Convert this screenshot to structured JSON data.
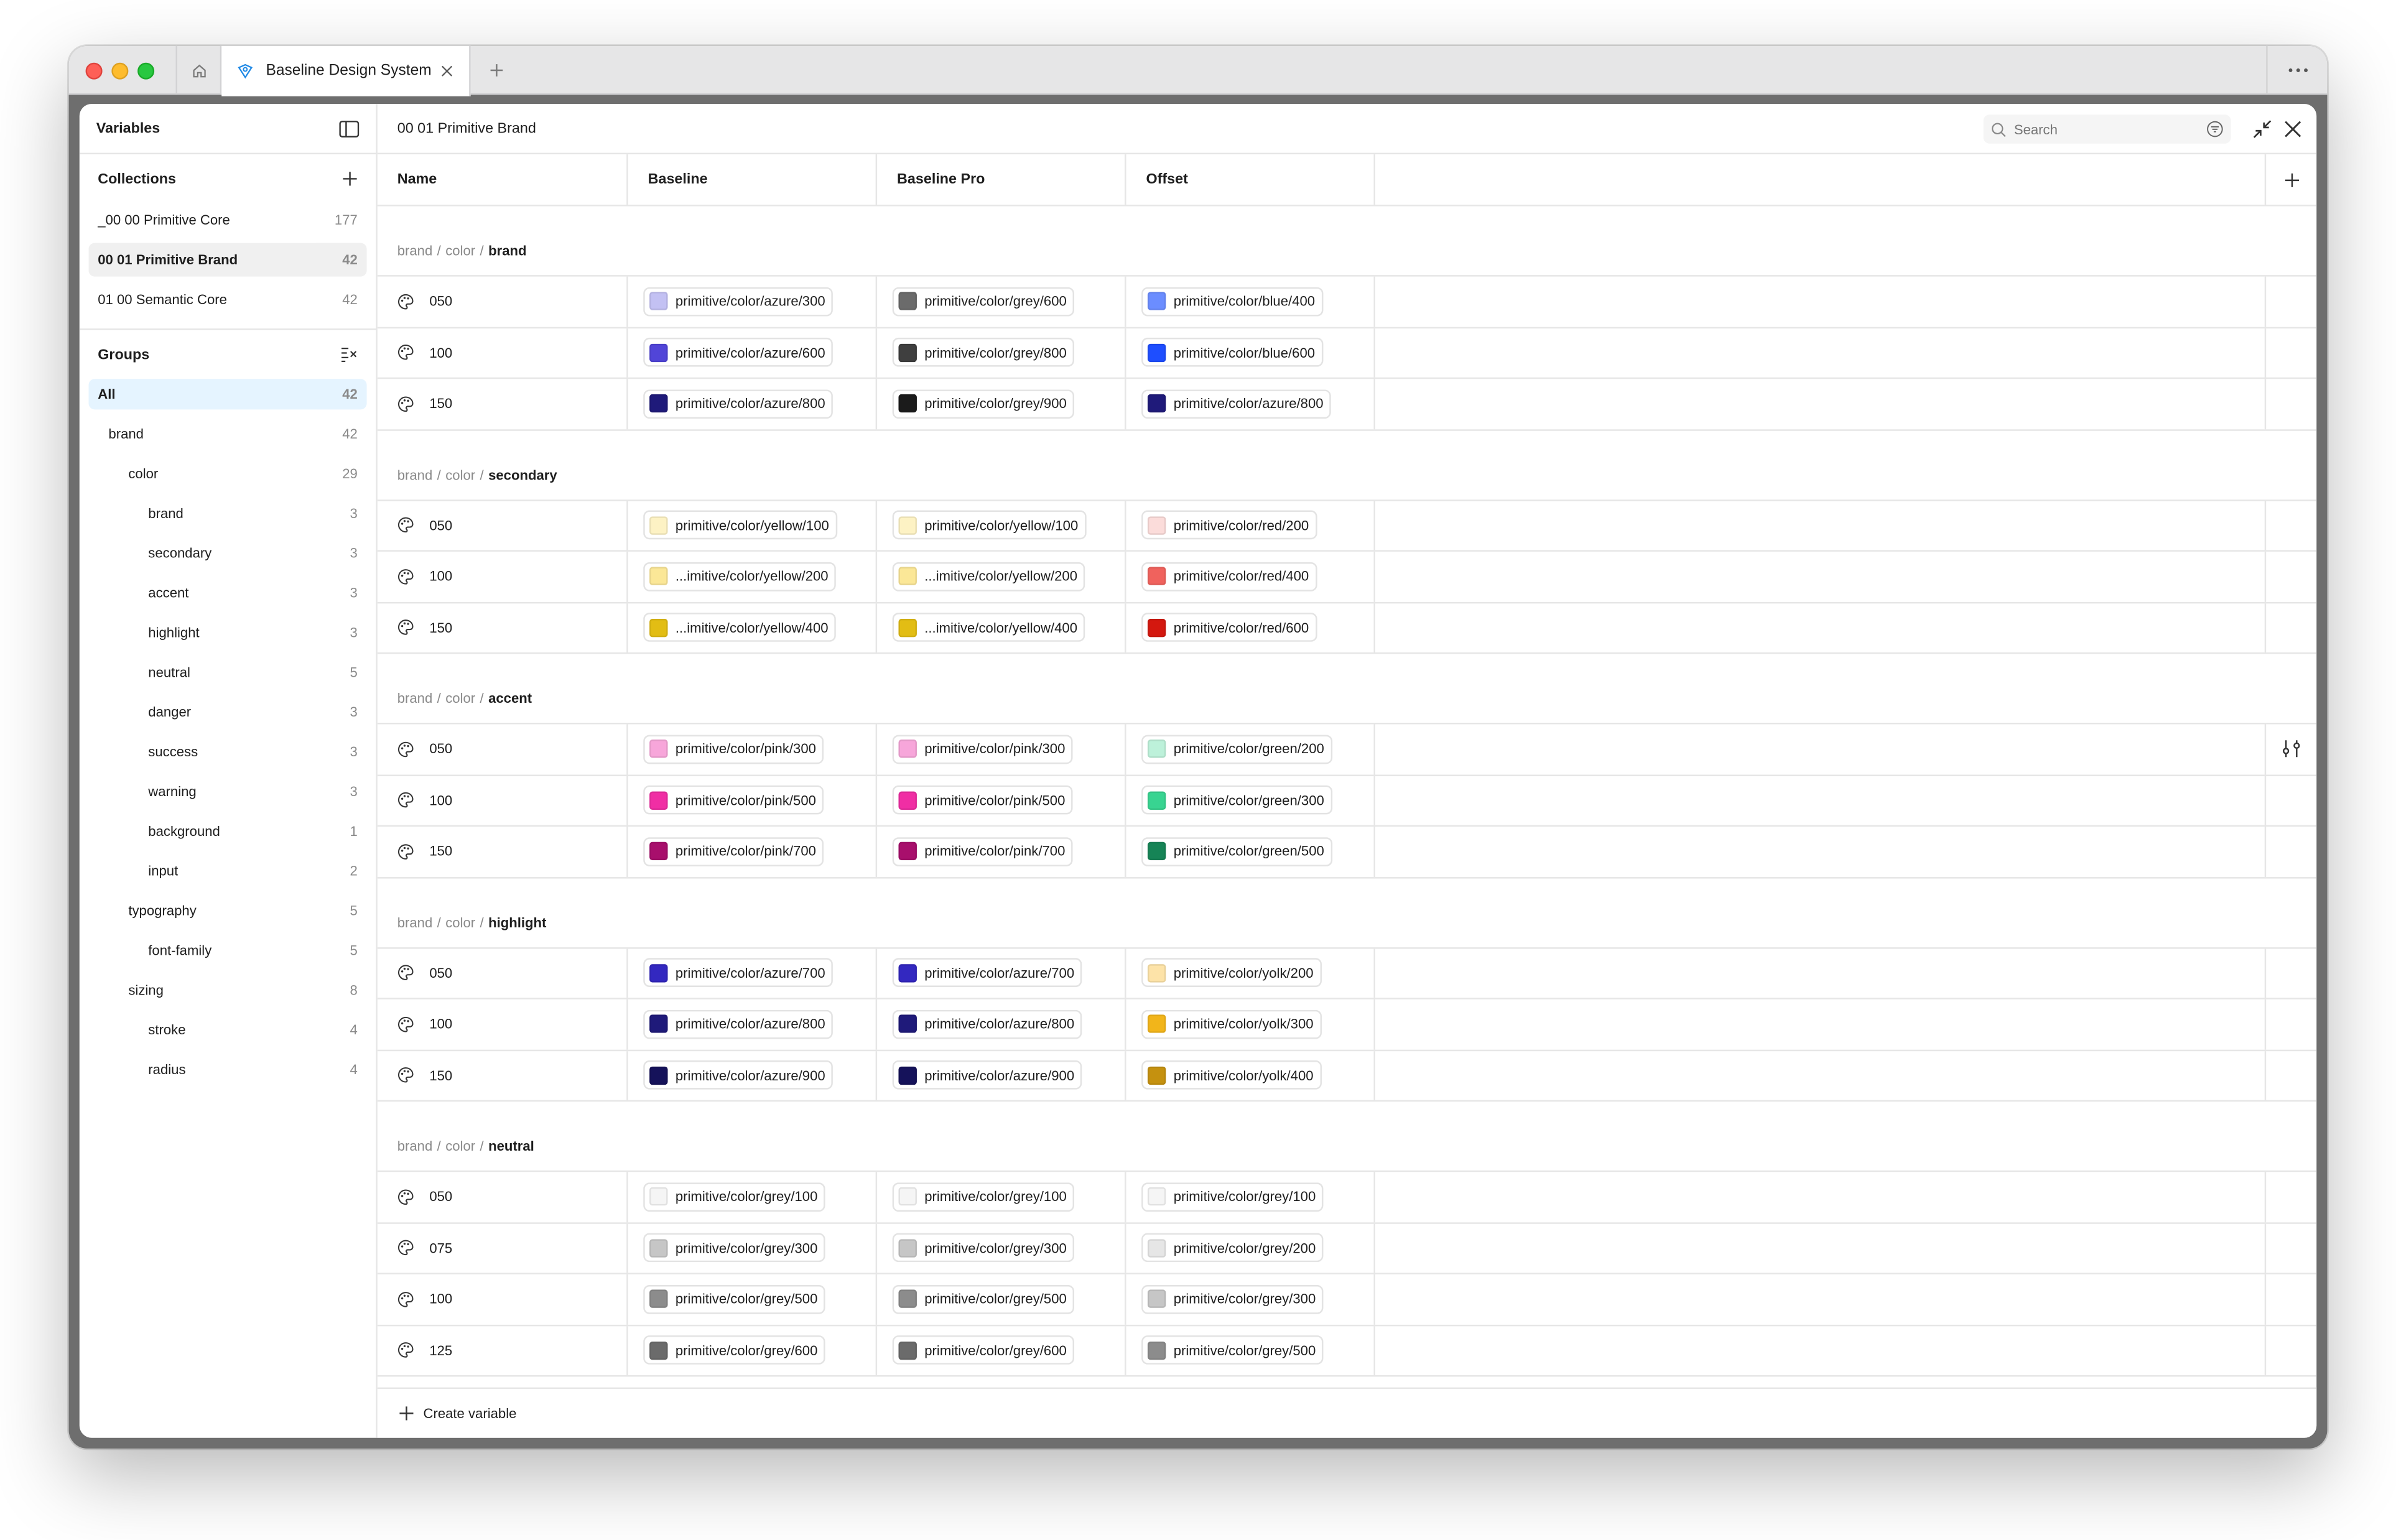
{
  "app": {
    "tab_title": "Baseline Design System",
    "icons": [
      "home-icon",
      "app-logo-icon",
      "close-icon",
      "plus-icon",
      "more-icon"
    ]
  },
  "sidebar": {
    "title": "Variables",
    "collections_label": "Collections",
    "collections": [
      {
        "name": "_00 00 Primitive Core",
        "count": "177",
        "active": false
      },
      {
        "name": "00 01 Primitive Brand",
        "count": "42",
        "active": true
      },
      {
        "name": "01 00 Semantic Core",
        "count": "42",
        "active": false
      }
    ],
    "groups_label": "Groups",
    "groups": [
      {
        "name": "All",
        "count": "42",
        "level": 0,
        "active": true
      },
      {
        "name": "brand",
        "count": "42",
        "level": 1
      },
      {
        "name": "color",
        "count": "29",
        "level": 2
      },
      {
        "name": "brand",
        "count": "3",
        "level": 3
      },
      {
        "name": "secondary",
        "count": "3",
        "level": 3
      },
      {
        "name": "accent",
        "count": "3",
        "level": 3
      },
      {
        "name": "highlight",
        "count": "3",
        "level": 3
      },
      {
        "name": "neutral",
        "count": "5",
        "level": 3
      },
      {
        "name": "danger",
        "count": "3",
        "level": 3
      },
      {
        "name": "success",
        "count": "3",
        "level": 3
      },
      {
        "name": "warning",
        "count": "3",
        "level": 3
      },
      {
        "name": "background",
        "count": "1",
        "level": 3
      },
      {
        "name": "input",
        "count": "2",
        "level": 3
      },
      {
        "name": "typography",
        "count": "5",
        "level": 2
      },
      {
        "name": "font-family",
        "count": "5",
        "level": 3
      },
      {
        "name": "sizing",
        "count": "8",
        "level": 2
      },
      {
        "name": "stroke",
        "count": "4",
        "level": 3
      },
      {
        "name": "radius",
        "count": "4",
        "level": 3
      }
    ]
  },
  "main": {
    "title": "00 01 Primitive Brand",
    "search_placeholder": "Search",
    "columns": {
      "name": "Name",
      "modes": [
        "Baseline",
        "Baseline Pro",
        "Offset"
      ]
    },
    "create_label": "Create variable",
    "groups": [
      {
        "path": [
          "brand",
          "color"
        ],
        "leaf": "brand",
        "rows": [
          {
            "name": "050",
            "values": [
              {
                "label": "primitive/color/azure/300",
                "color": "#c3c1f3"
              },
              {
                "label": "primitive/color/grey/600",
                "color": "#6b6b6b"
              },
              {
                "label": "primitive/color/blue/400",
                "color": "#6b8dff"
              }
            ]
          },
          {
            "name": "100",
            "values": [
              {
                "label": "primitive/color/azure/600",
                "color": "#5145d8"
              },
              {
                "label": "primitive/color/grey/800",
                "color": "#3f3f3f"
              },
              {
                "label": "primitive/color/blue/600",
                "color": "#1e4eff"
              }
            ]
          },
          {
            "name": "150",
            "values": [
              {
                "label": "primitive/color/azure/800",
                "color": "#1f1a7a"
              },
              {
                "label": "primitive/color/grey/900",
                "color": "#1b1b1b"
              },
              {
                "label": "primitive/color/azure/800",
                "color": "#1f1a7a"
              }
            ]
          }
        ]
      },
      {
        "path": [
          "brand",
          "color"
        ],
        "leaf": "secondary",
        "rows": [
          {
            "name": "050",
            "values": [
              {
                "label": "primitive/color/yellow/100",
                "color": "#fdf2c4"
              },
              {
                "label": "primitive/color/yellow/100",
                "color": "#fdf2c4"
              },
              {
                "label": "primitive/color/red/200",
                "color": "#fbdcda"
              }
            ]
          },
          {
            "name": "100",
            "values": [
              {
                "label": "...imitive/color/yellow/200",
                "color": "#fbe797"
              },
              {
                "label": "...imitive/color/yellow/200",
                "color": "#fbe797"
              },
              {
                "label": "primitive/color/red/400",
                "color": "#f0625d"
              }
            ]
          },
          {
            "name": "150",
            "values": [
              {
                "label": "...imitive/color/yellow/400",
                "color": "#e2bd14"
              },
              {
                "label": "...imitive/color/yellow/400",
                "color": "#e2bd14"
              },
              {
                "label": "primitive/color/red/600",
                "color": "#d4180f"
              }
            ]
          }
        ]
      },
      {
        "path": [
          "brand",
          "color"
        ],
        "leaf": "accent",
        "rows": [
          {
            "name": "050",
            "values": [
              {
                "label": "primitive/color/pink/300",
                "color": "#f7a6da"
              },
              {
                "label": "primitive/color/pink/300",
                "color": "#f7a6da"
              },
              {
                "label": "primitive/color/green/200",
                "color": "#bdf1da"
              }
            ]
          },
          {
            "name": "100",
            "values": [
              {
                "label": "primitive/color/pink/500",
                "color": "#f02ea4"
              },
              {
                "label": "primitive/color/pink/500",
                "color": "#f02ea4"
              },
              {
                "label": "primitive/color/green/300",
                "color": "#38d491"
              }
            ]
          },
          {
            "name": "150",
            "values": [
              {
                "label": "primitive/color/pink/700",
                "color": "#a80f6c"
              },
              {
                "label": "primitive/color/pink/700",
                "color": "#a80f6c"
              },
              {
                "label": "primitive/color/green/500",
                "color": "#168456"
              }
            ]
          }
        ]
      },
      {
        "path": [
          "brand",
          "color"
        ],
        "leaf": "highlight",
        "rows": [
          {
            "name": "050",
            "values": [
              {
                "label": "primitive/color/azure/700",
                "color": "#3328c0"
              },
              {
                "label": "primitive/color/azure/700",
                "color": "#3328c0"
              },
              {
                "label": "primitive/color/yolk/200",
                "color": "#fde3a8"
              }
            ]
          },
          {
            "name": "100",
            "values": [
              {
                "label": "primitive/color/azure/800",
                "color": "#1f1a7a"
              },
              {
                "label": "primitive/color/azure/800",
                "color": "#1f1a7a"
              },
              {
                "label": "primitive/color/yolk/300",
                "color": "#f2b51a"
              }
            ]
          },
          {
            "name": "150",
            "values": [
              {
                "label": "primitive/color/azure/900",
                "color": "#15125a"
              },
              {
                "label": "primitive/color/azure/900",
                "color": "#15125a"
              },
              {
                "label": "primitive/color/yolk/400",
                "color": "#c5910f"
              }
            ]
          }
        ]
      },
      {
        "path": [
          "brand",
          "color"
        ],
        "leaf": "neutral",
        "rows": [
          {
            "name": "050",
            "values": [
              {
                "label": "primitive/color/grey/100",
                "color": "#f5f5f5"
              },
              {
                "label": "primitive/color/grey/100",
                "color": "#f5f5f5"
              },
              {
                "label": "primitive/color/grey/100",
                "color": "#f5f5f5"
              }
            ]
          },
          {
            "name": "075",
            "values": [
              {
                "label": "primitive/color/grey/300",
                "color": "#c6c6c6"
              },
              {
                "label": "primitive/color/grey/300",
                "color": "#c6c6c6"
              },
              {
                "label": "primitive/color/grey/200",
                "color": "#e6e6e6"
              }
            ]
          },
          {
            "name": "100",
            "values": [
              {
                "label": "primitive/color/grey/500",
                "color": "#8c8c8c"
              },
              {
                "label": "primitive/color/grey/500",
                "color": "#8c8c8c"
              },
              {
                "label": "primitive/color/grey/300",
                "color": "#c6c6c6"
              }
            ]
          },
          {
            "name": "125",
            "values": [
              {
                "label": "primitive/color/grey/600",
                "color": "#6b6b6b"
              },
              {
                "label": "primitive/color/grey/600",
                "color": "#6b6b6b"
              },
              {
                "label": "primitive/color/grey/500",
                "color": "#8c8c8c"
              }
            ]
          }
        ]
      }
    ]
  }
}
